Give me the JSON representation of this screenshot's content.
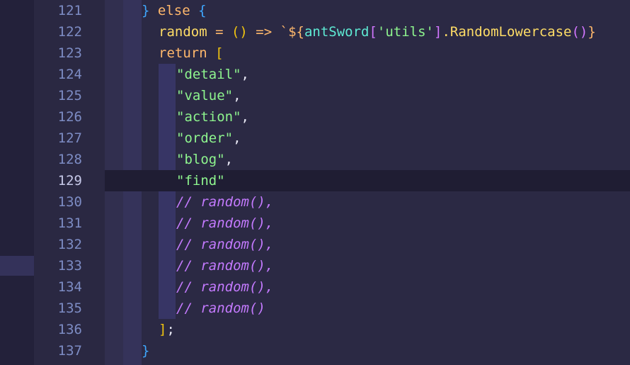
{
  "editor": {
    "lines": [
      {
        "n": "121",
        "parts": [
          {
            "t": "} ",
            "c": "brace-blue"
          },
          {
            "t": "else ",
            "c": "kw"
          },
          {
            "t": "{",
            "c": "brace-blue"
          }
        ]
      },
      {
        "n": "122",
        "parts": [
          {
            "t": "random",
            "c": "ident"
          },
          {
            "t": " = ",
            "c": "op"
          },
          {
            "t": "()",
            "c": "brace-gold"
          },
          {
            "t": " => ",
            "c": "op"
          },
          {
            "t": "`${",
            "c": "tmpl"
          },
          {
            "t": "antSword",
            "c": "teal"
          },
          {
            "t": "[",
            "c": "brace-pink"
          },
          {
            "t": "'utils'",
            "c": "str"
          },
          {
            "t": "]",
            "c": "brace-pink"
          },
          {
            "t": ".RandomLowercase",
            "c": "ident"
          },
          {
            "t": "()",
            "c": "brace-pink"
          },
          {
            "t": "}",
            "c": "tmpl"
          }
        ]
      },
      {
        "n": "123",
        "parts": [
          {
            "t": "return ",
            "c": "kw"
          },
          {
            "t": "[",
            "c": "brace-gold"
          }
        ]
      },
      {
        "n": "124",
        "parts": [
          {
            "t": "\"detail\"",
            "c": "str"
          },
          {
            "t": ",",
            "c": "white"
          }
        ]
      },
      {
        "n": "125",
        "parts": [
          {
            "t": "\"value\"",
            "c": "str"
          },
          {
            "t": ",",
            "c": "white"
          }
        ]
      },
      {
        "n": "126",
        "parts": [
          {
            "t": "\"action\"",
            "c": "str"
          },
          {
            "t": ",",
            "c": "white"
          }
        ]
      },
      {
        "n": "127",
        "parts": [
          {
            "t": "\"order\"",
            "c": "str"
          },
          {
            "t": ",",
            "c": "white"
          }
        ]
      },
      {
        "n": "128",
        "parts": [
          {
            "t": "\"blog\"",
            "c": "str"
          },
          {
            "t": ",",
            "c": "white"
          }
        ]
      },
      {
        "n": "129",
        "parts": [
          {
            "t": "\"find\"",
            "c": "str"
          }
        ]
      },
      {
        "n": "130",
        "parts": [
          {
            "t": "// random(),",
            "c": "cmt"
          }
        ]
      },
      {
        "n": "131",
        "parts": [
          {
            "t": "// random(),",
            "c": "cmt"
          }
        ]
      },
      {
        "n": "132",
        "parts": [
          {
            "t": "// random(),",
            "c": "cmt"
          }
        ]
      },
      {
        "n": "133",
        "parts": [
          {
            "t": "// random(),",
            "c": "cmt"
          }
        ]
      },
      {
        "n": "134",
        "parts": [
          {
            "t": "// random(),",
            "c": "cmt"
          }
        ]
      },
      {
        "n": "135",
        "parts": [
          {
            "t": "// random()",
            "c": "cmt"
          }
        ]
      },
      {
        "n": "136",
        "parts": [
          {
            "t": "]",
            "c": "brace-gold"
          },
          {
            "t": ";",
            "c": "white"
          }
        ]
      },
      {
        "n": "137",
        "parts": [
          {
            "t": "}",
            "c": "brace-blue"
          }
        ]
      }
    ],
    "active_line": "129"
  }
}
